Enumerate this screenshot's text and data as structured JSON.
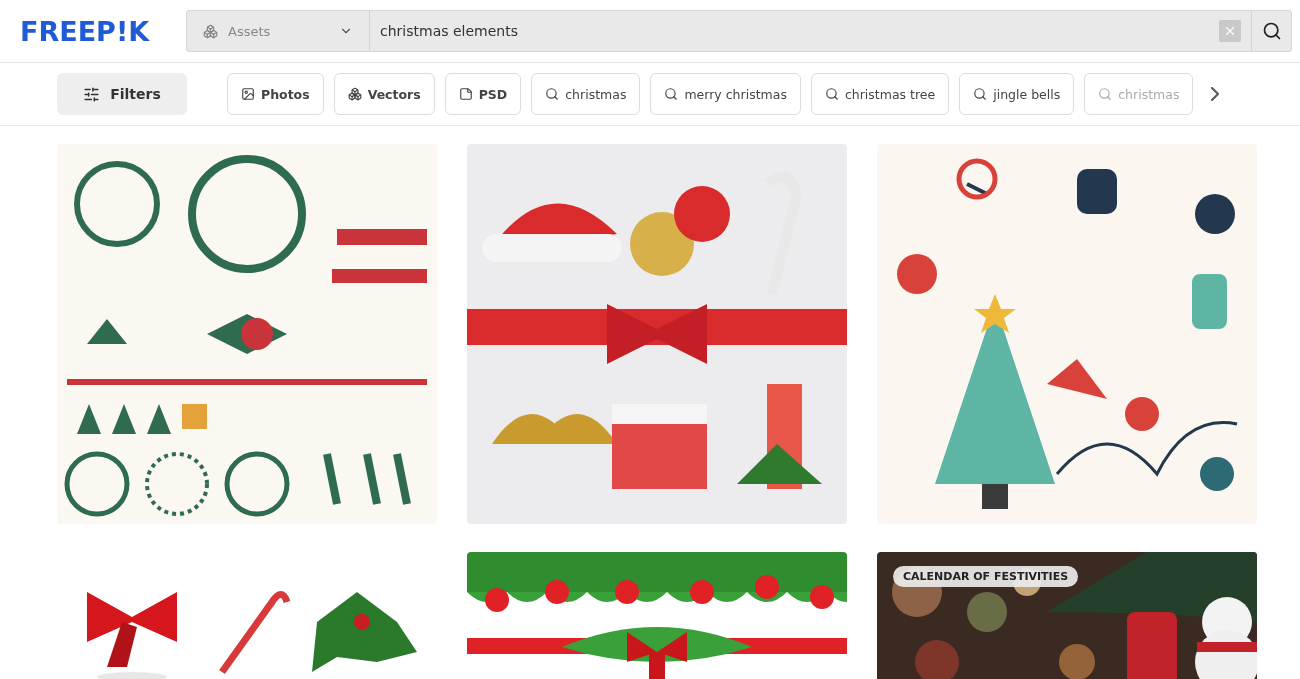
{
  "header": {
    "logo": "FREEP!K",
    "search": {
      "category": "Assets",
      "value": "christmas elements"
    }
  },
  "filters_button": "Filters",
  "chips": [
    {
      "kind": "category",
      "label": "Photos"
    },
    {
      "kind": "category",
      "label": "Vectors"
    },
    {
      "kind": "category",
      "label": "PSD"
    },
    {
      "kind": "search",
      "label": "christmas"
    },
    {
      "kind": "search",
      "label": "merry christmas"
    },
    {
      "kind": "search",
      "label": "christmas tree"
    },
    {
      "kind": "search",
      "label": "jingle bells"
    },
    {
      "kind": "search",
      "label": "christmas",
      "faded": true
    }
  ],
  "cards": [
    {
      "kind": "picture"
    },
    {
      "kind": "picture"
    },
    {
      "kind": "picture"
    },
    {
      "kind": "picture"
    },
    {
      "kind": "picture"
    },
    {
      "kind": "picture",
      "badge": "CALENDAR OF FESTIVITIES"
    }
  ]
}
